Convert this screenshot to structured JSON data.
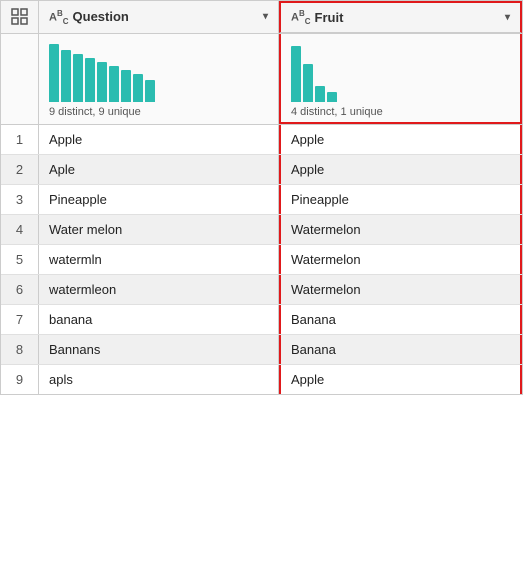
{
  "columns": {
    "rowNum": {
      "icon": "⊞"
    },
    "question": {
      "typeIcon": "ABC",
      "label": "Question",
      "chart": {
        "bars": [
          58,
          52,
          48,
          44,
          40,
          36,
          32,
          28,
          24
        ],
        "label": "9 distinct, 9 unique"
      }
    },
    "fruit": {
      "typeIcon": "ABC",
      "label": "Fruit",
      "chart": {
        "bars": [
          56,
          38,
          16,
          10
        ],
        "label": "4 distinct, 1 unique"
      }
    }
  },
  "rows": [
    {
      "num": "1",
      "question": "Apple",
      "fruit": "Apple"
    },
    {
      "num": "2",
      "question": "Aple",
      "fruit": "Apple"
    },
    {
      "num": "3",
      "question": "Pineapple",
      "fruit": "Pineapple"
    },
    {
      "num": "4",
      "question": "Water melon",
      "fruit": "Watermelon"
    },
    {
      "num": "5",
      "question": "watermln",
      "fruit": "Watermelon"
    },
    {
      "num": "6",
      "question": "watermleon",
      "fruit": "Watermelon"
    },
    {
      "num": "7",
      "question": "banana",
      "fruit": "Banana"
    },
    {
      "num": "8",
      "question": "Bannans",
      "fruit": "Banana"
    },
    {
      "num": "9",
      "question": "apls",
      "fruit": "Apple"
    }
  ],
  "icons": {
    "grid": "⊞",
    "abc": "Aᴮc",
    "dropdown": "▾"
  }
}
